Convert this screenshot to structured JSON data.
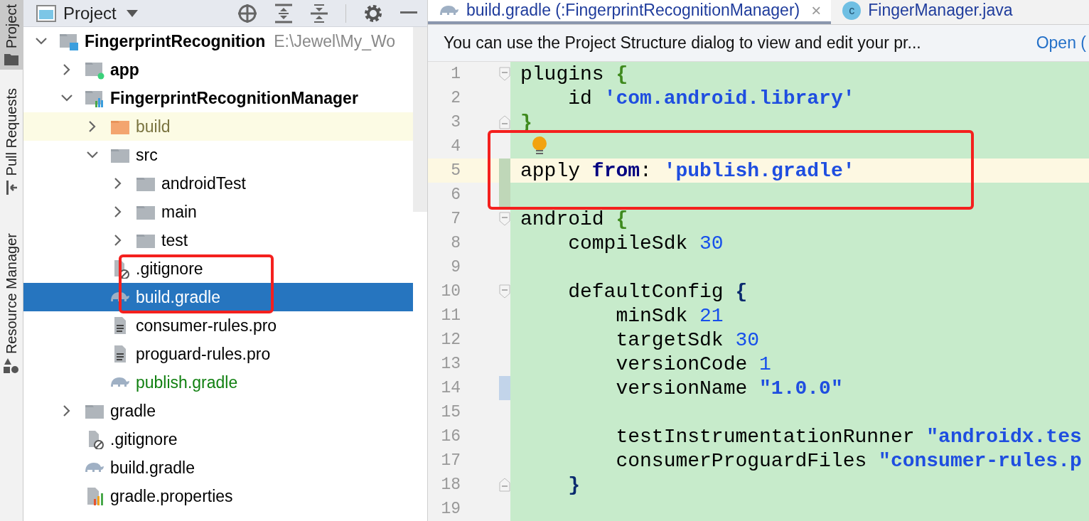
{
  "tool_strip": [
    {
      "label": "Project",
      "selected": true,
      "kind": "folder"
    },
    {
      "label": "Pull Requests",
      "selected": false,
      "kind": "pull"
    },
    {
      "label": "Resource Manager",
      "selected": false,
      "kind": "shapes"
    }
  ],
  "project_panel": {
    "title": "Project",
    "tree": [
      {
        "label": "FingerprintRecognition",
        "detail": "E:\\Jewel\\My_Wo",
        "kind": "project",
        "bold": true,
        "expanded": true,
        "selected": false,
        "excluded": false,
        "added": false,
        "annotated": false,
        "children": [
          {
            "label": "app",
            "kind": "app-module",
            "bold": true,
            "expanded": false,
            "selected": false,
            "excluded": false,
            "added": false,
            "annotated": false
          },
          {
            "label": "FingerprintRecognitionManager",
            "kind": "lib-module",
            "bold": true,
            "expanded": true,
            "selected": false,
            "excluded": false,
            "added": false,
            "annotated": false,
            "children": [
              {
                "label": "build",
                "kind": "excluded-folder",
                "bold": false,
                "expanded": false,
                "selected": false,
                "excluded": true,
                "added": false,
                "annotated": false
              },
              {
                "label": "src",
                "kind": "folder",
                "bold": false,
                "expanded": true,
                "selected": false,
                "excluded": false,
                "added": false,
                "annotated": false,
                "children": [
                  {
                    "label": "androidTest",
                    "kind": "folder",
                    "bold": false,
                    "expanded": false,
                    "selected": false,
                    "excluded": false,
                    "added": false,
                    "annotated": false
                  },
                  {
                    "label": "main",
                    "kind": "folder",
                    "bold": false,
                    "expanded": false,
                    "selected": false,
                    "excluded": false,
                    "added": false,
                    "annotated": false
                  },
                  {
                    "label": "test",
                    "kind": "folder",
                    "bold": false,
                    "expanded": false,
                    "selected": false,
                    "excluded": false,
                    "added": false,
                    "annotated": false
                  }
                ]
              },
              {
                "label": ".gitignore",
                "kind": "gitignore",
                "bold": false,
                "selected": false,
                "excluded": false,
                "added": false,
                "annotated": true
              },
              {
                "label": "build.gradle",
                "kind": "gradle",
                "bold": false,
                "selected": true,
                "excluded": false,
                "added": false,
                "annotated": true
              },
              {
                "label": "consumer-rules.pro",
                "kind": "text",
                "bold": false,
                "selected": false,
                "excluded": false,
                "added": false,
                "annotated": false
              },
              {
                "label": "proguard-rules.pro",
                "kind": "text",
                "bold": false,
                "selected": false,
                "excluded": false,
                "added": false,
                "annotated": false
              },
              {
                "label": "publish.gradle",
                "kind": "gradle",
                "bold": false,
                "selected": false,
                "excluded": false,
                "added": true,
                "annotated": false
              }
            ]
          },
          {
            "label": "gradle",
            "kind": "folder",
            "bold": false,
            "expanded": false,
            "selected": false,
            "excluded": false,
            "added": false,
            "annotated": false
          },
          {
            "label": ".gitignore",
            "kind": "gitignore",
            "bold": false,
            "selected": false,
            "excluded": false,
            "added": false,
            "annotated": false
          },
          {
            "label": "build.gradle",
            "kind": "gradle",
            "bold": false,
            "selected": false,
            "excluded": false,
            "added": false,
            "annotated": false
          },
          {
            "label": "gradle.properties",
            "kind": "properties",
            "bold": false,
            "selected": false,
            "excluded": false,
            "added": false,
            "annotated": false
          }
        ]
      }
    ]
  },
  "editor": {
    "tabs": [
      {
        "label": "build.gradle (:FingerprintRecognitionManager)",
        "kind": "gradle",
        "selected": true,
        "close": "×"
      },
      {
        "label": "FingerManager.java",
        "kind": "class",
        "selected": false,
        "badge": "c"
      }
    ],
    "notification": {
      "text": "You can use the Project Structure dialog to view and edit your pr...",
      "link": "Open ("
    },
    "lines": [
      {
        "number": "1",
        "fold_open": true,
        "tokens": [
          {
            "kind": "plain",
            "text": "plugins "
          },
          {
            "kind": "brace-outer",
            "text": "{"
          }
        ]
      },
      {
        "number": "2",
        "tokens": [
          {
            "kind": "plain",
            "text": "    id "
          },
          {
            "kind": "string",
            "text": "'com.android.library'"
          }
        ]
      },
      {
        "number": "3",
        "fold_close": true,
        "tokens": [
          {
            "kind": "brace-outer",
            "text": "}"
          }
        ]
      },
      {
        "number": "4",
        "annotated": true,
        "bulb": true
      },
      {
        "number": "5",
        "annotated": true,
        "current": true,
        "added": true,
        "tokens": [
          {
            "kind": "plain",
            "text": "apply "
          },
          {
            "kind": "keyword",
            "text": "from"
          },
          {
            "kind": "plain",
            "text": ": "
          },
          {
            "kind": "string",
            "text": "'publish.gradle'"
          }
        ]
      },
      {
        "number": "6",
        "annotated": true,
        "added": true
      },
      {
        "number": "7",
        "fold_open": true,
        "tokens": [
          {
            "kind": "plain",
            "text": "android "
          },
          {
            "kind": "brace-outer",
            "text": "{"
          }
        ]
      },
      {
        "number": "8",
        "tokens": [
          {
            "kind": "plain",
            "text": "    compileSdk "
          },
          {
            "kind": "number",
            "text": "30"
          }
        ]
      },
      {
        "number": "9"
      },
      {
        "number": "10",
        "fold_open": true,
        "tokens": [
          {
            "kind": "plain",
            "text": "    defaultConfig "
          },
          {
            "kind": "brace-inner",
            "text": "{"
          }
        ]
      },
      {
        "number": "11",
        "tokens": [
          {
            "kind": "plain",
            "text": "        minSdk "
          },
          {
            "kind": "number",
            "text": "21"
          }
        ]
      },
      {
        "number": "12",
        "tokens": [
          {
            "kind": "plain",
            "text": "        targetSdk "
          },
          {
            "kind": "number",
            "text": "30"
          }
        ]
      },
      {
        "number": "13",
        "tokens": [
          {
            "kind": "plain",
            "text": "        versionCode "
          },
          {
            "kind": "number",
            "text": "1"
          }
        ]
      },
      {
        "number": "14",
        "modified": true,
        "tokens": [
          {
            "kind": "plain",
            "text": "        versionName "
          },
          {
            "kind": "string",
            "text": "\"1.0.0\""
          }
        ]
      },
      {
        "number": "15"
      },
      {
        "number": "16",
        "tokens": [
          {
            "kind": "plain",
            "text": "        testInstrumentationRunner "
          },
          {
            "kind": "string",
            "text": "\"androidx.tes"
          }
        ]
      },
      {
        "number": "17",
        "tokens": [
          {
            "kind": "plain",
            "text": "        consumerProguardFiles "
          },
          {
            "kind": "string",
            "text": "\"consumer-rules.p"
          }
        ]
      },
      {
        "number": "18",
        "fold_close": true,
        "tokens": [
          {
            "kind": "brace-inner",
            "text": "    }"
          }
        ]
      },
      {
        "number": "19"
      }
    ]
  }
}
